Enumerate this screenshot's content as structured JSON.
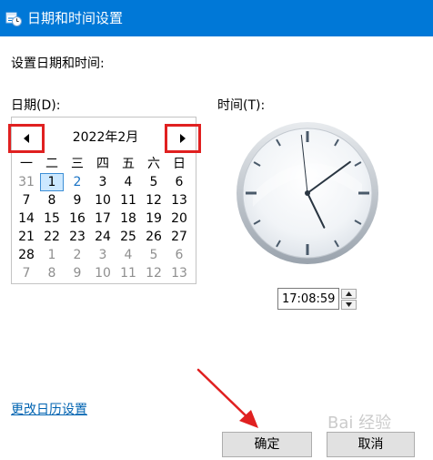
{
  "window": {
    "title": "日期和时间设置",
    "app_icon": "date-time-settings-icon",
    "accent_color": "#0078d7"
  },
  "heading": "设置日期和时间:",
  "date": {
    "label": "日期(D):",
    "month_title": "2022年2月",
    "weekdays": [
      "一",
      "二",
      "三",
      "四",
      "五",
      "六",
      "日"
    ],
    "weeks": [
      [
        "31",
        "1",
        "2",
        "3",
        "4",
        "5",
        "6"
      ],
      [
        "7",
        "8",
        "9",
        "10",
        "11",
        "12",
        "13"
      ],
      [
        "14",
        "15",
        "16",
        "17",
        "18",
        "19",
        "20"
      ],
      [
        "21",
        "22",
        "23",
        "24",
        "25",
        "26",
        "27"
      ],
      [
        "28",
        "1",
        "2",
        "3",
        "4",
        "5",
        "6"
      ],
      [
        "7",
        "8",
        "9",
        "10",
        "11",
        "12",
        "13"
      ]
    ],
    "selected_day": "1",
    "today_day": "2",
    "prev_icon": "triangle-left-icon",
    "next_icon": "triangle-right-icon",
    "highlight_color": "#e02020"
  },
  "time": {
    "label": "时间(T):",
    "value": "17:08:59",
    "clock": {
      "hour": 17,
      "minute": 8,
      "second": 59
    }
  },
  "calendar_link": "更改日历设置",
  "buttons": {
    "ok": "确定",
    "cancel": "取消"
  },
  "annotation": {
    "arrow_color": "#e02020",
    "arrow_target": "ok-button"
  },
  "watermark": "Bai 经验"
}
